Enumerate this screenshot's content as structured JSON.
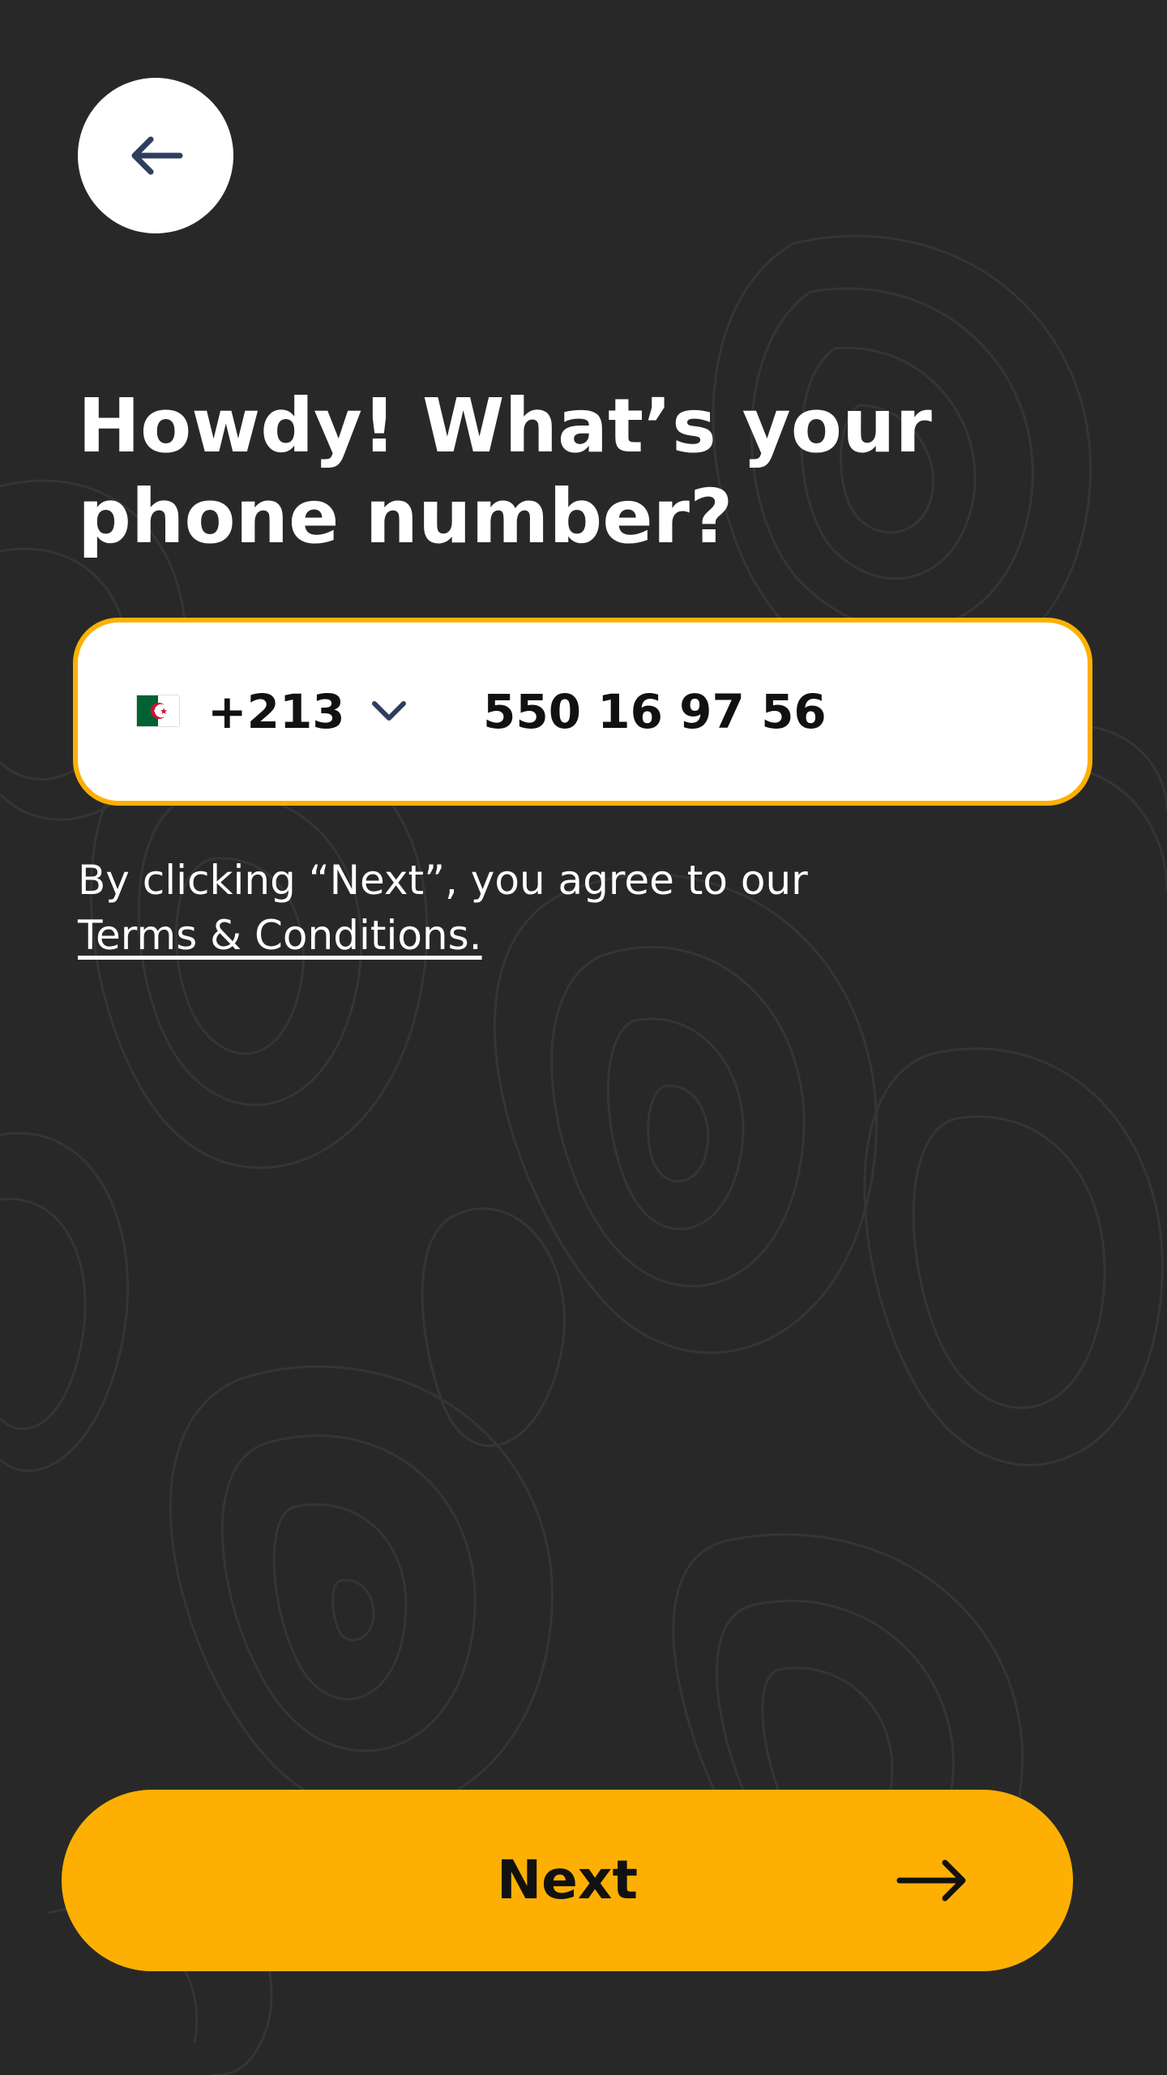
{
  "header": {
    "back_icon": "arrow-left-icon"
  },
  "title": {
    "line1": "Howdy! What’s your",
    "line2": "phone number?"
  },
  "phone": {
    "country_flag": "algeria-flag-icon",
    "country_code": "+213",
    "number": "550 16 97 56",
    "dropdown_icon": "chevron-down-icon"
  },
  "terms": {
    "prefix": "By clicking “Next”, you agree to our",
    "link": "Terms & Conditions."
  },
  "next_button": {
    "label": "Next",
    "icon": "arrow-right-icon"
  },
  "colors": {
    "background": "#282828",
    "accent": "#FDB003",
    "surface": "#FFFFFF",
    "text_dark": "#111111",
    "icon_navy": "#2F3E5C"
  }
}
